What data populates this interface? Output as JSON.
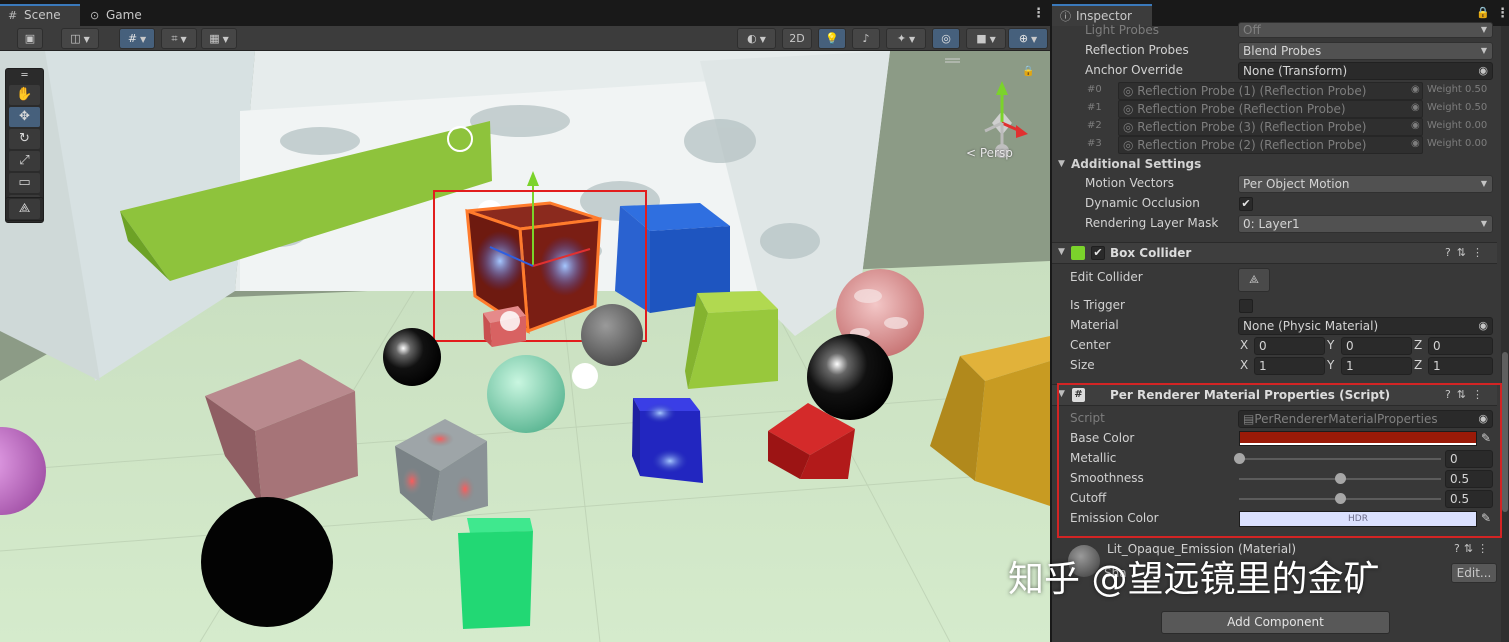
{
  "scene": {
    "tabs": [
      {
        "label": "Scene",
        "icon": "hash-grid-icon"
      },
      {
        "label": "Game",
        "icon": "gamepad-icon"
      }
    ],
    "toolbar": {
      "btn_2d": "2D",
      "persp_label": "< Persp"
    }
  },
  "inspector": {
    "tab_label": "Inspector",
    "rows": {
      "light_probes": {
        "label": "Light Probes",
        "value": "Off"
      },
      "reflection_probes": {
        "label": "Reflection Probes",
        "value": "Blend Probes"
      },
      "anchor_override": {
        "label": "Anchor Override",
        "value": "None (Transform)"
      }
    },
    "probes": [
      {
        "index": "#0",
        "name": "Reflection Probe (1) (Reflection Probe)",
        "weight": "Weight 0.50"
      },
      {
        "index": "#1",
        "name": "Reflection Probe (Reflection Probe)",
        "weight": "Weight 0.50"
      },
      {
        "index": "#2",
        "name": "Reflection Probe (3) (Reflection Probe)",
        "weight": "Weight 0.00"
      },
      {
        "index": "#3",
        "name": "Reflection Probe (2) (Reflection Probe)",
        "weight": "Weight 0.00"
      }
    ],
    "additional_settings": {
      "title": "Additional Settings",
      "motion_vectors": {
        "label": "Motion Vectors",
        "value": "Per Object Motion"
      },
      "dynamic_occlusion": {
        "label": "Dynamic Occlusion",
        "checked": true
      },
      "rendering_layer_mask": {
        "label": "Rendering Layer Mask",
        "value": "0: Layer1"
      }
    },
    "box_collider": {
      "title": "Box Collider",
      "edit_collider": "Edit Collider",
      "is_trigger": "Is Trigger",
      "material": {
        "label": "Material",
        "value": "None (Physic Material)"
      },
      "center": {
        "label": "Center",
        "x": "0",
        "y": "0",
        "z": "0"
      },
      "size": {
        "label": "Size",
        "x": "1",
        "y": "1",
        "z": "1"
      }
    },
    "script_component": {
      "title": "Per Renderer Material Properties (Script)",
      "script": {
        "label": "Script",
        "value": "PerRendererMaterialProperties"
      },
      "base_color": {
        "label": "Base Color",
        "color": "#9a1a08"
      },
      "metallic": {
        "label": "Metallic",
        "value": "0",
        "fraction": 0
      },
      "smoothness": {
        "label": "Smoothness",
        "value": "0.5",
        "fraction": 0.5
      },
      "cutoff": {
        "label": "Cutoff",
        "value": "0.5",
        "fraction": 0.5
      },
      "emission_color": {
        "label": "Emission Color",
        "tag": "HDR",
        "color": "#dbe1ff"
      }
    },
    "material": {
      "name": "Lit_Opaque_Emission (Material)",
      "shader_label": "Sha",
      "edit_button": "Edit..."
    },
    "add_component": "Add Component"
  },
  "watermark": "知乎 @望远镜里的金矿"
}
